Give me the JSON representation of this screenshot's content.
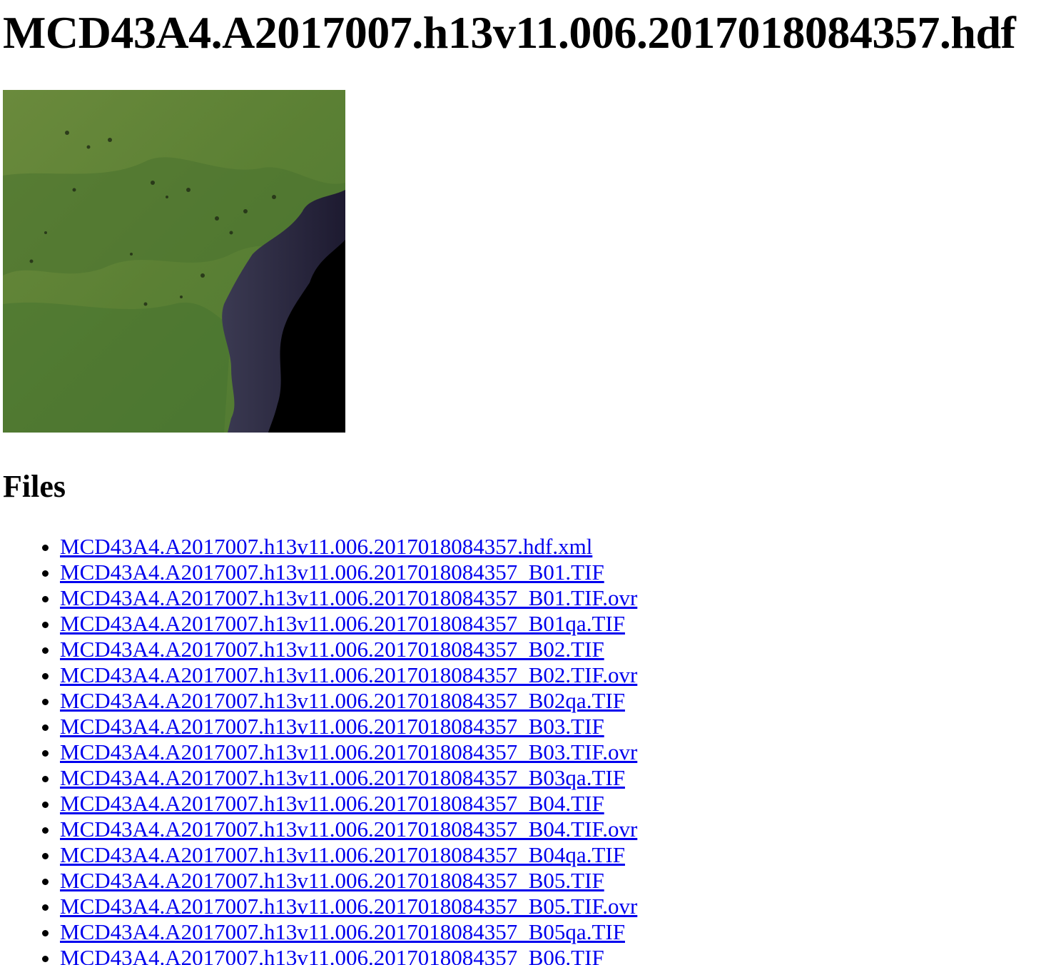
{
  "page": {
    "title": "MCD43A4.A2017007.h13v11.006.2017018084357.hdf",
    "preview_image": {
      "alt": "",
      "colors": {
        "land": "#5a7f35",
        "land_dark": "#3f6a2c",
        "ocean": "#000000",
        "coast": "#2b2648"
      }
    },
    "files_heading": "Files",
    "link_color": "#0000ee",
    "files": [
      "MCD43A4.A2017007.h13v11.006.2017018084357.hdf.xml",
      "MCD43A4.A2017007.h13v11.006.2017018084357_B01.TIF",
      "MCD43A4.A2017007.h13v11.006.2017018084357_B01.TIF.ovr",
      "MCD43A4.A2017007.h13v11.006.2017018084357_B01qa.TIF",
      "MCD43A4.A2017007.h13v11.006.2017018084357_B02.TIF",
      "MCD43A4.A2017007.h13v11.006.2017018084357_B02.TIF.ovr",
      "MCD43A4.A2017007.h13v11.006.2017018084357_B02qa.TIF",
      "MCD43A4.A2017007.h13v11.006.2017018084357_B03.TIF",
      "MCD43A4.A2017007.h13v11.006.2017018084357_B03.TIF.ovr",
      "MCD43A4.A2017007.h13v11.006.2017018084357_B03qa.TIF",
      "MCD43A4.A2017007.h13v11.006.2017018084357_B04.TIF",
      "MCD43A4.A2017007.h13v11.006.2017018084357_B04.TIF.ovr",
      "MCD43A4.A2017007.h13v11.006.2017018084357_B04qa.TIF",
      "MCD43A4.A2017007.h13v11.006.2017018084357_B05.TIF",
      "MCD43A4.A2017007.h13v11.006.2017018084357_B05.TIF.ovr",
      "MCD43A4.A2017007.h13v11.006.2017018084357_B05qa.TIF",
      "MCD43A4.A2017007.h13v11.006.2017018084357_B06.TIF"
    ]
  }
}
